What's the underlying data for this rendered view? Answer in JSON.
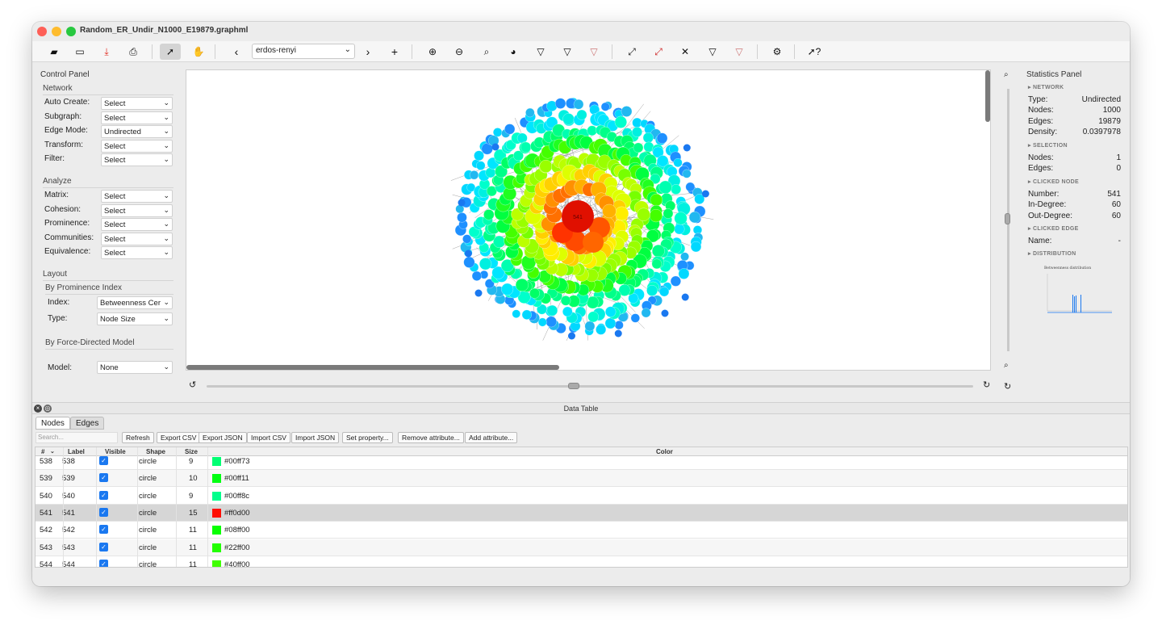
{
  "window": {
    "title": "Random_ER_Undir_N1000_E19879.graphml"
  },
  "toolbar": {
    "network_select": "erdos-renyi",
    "prev_glyph": "‹",
    "next_glyph": "›",
    "add_glyph": "+"
  },
  "control_panel": {
    "title": "Control Panel",
    "network_section": "Network",
    "network_rows": [
      {
        "label": "Auto Create:",
        "value": "Select"
      },
      {
        "label": "Subgraph:",
        "value": "Select"
      },
      {
        "label": "Edge Mode:",
        "value": "Undirected"
      },
      {
        "label": "Transform:",
        "value": "Select"
      },
      {
        "label": "Filter:",
        "value": "Select"
      }
    ],
    "analyze_section": "Analyze",
    "analyze_rows": [
      {
        "label": "Matrix:",
        "value": "Select"
      },
      {
        "label": "Cohesion:",
        "value": "Select"
      },
      {
        "label": "Prominence:",
        "value": "Select"
      },
      {
        "label": "Communities:",
        "value": "Select"
      },
      {
        "label": "Equivalence:",
        "value": "Select"
      }
    ],
    "layout_section": "Layout",
    "prominence_subsection": "By Prominence Index",
    "index_label": "Index:",
    "index_value": "Betweenness Cer",
    "type_label": "Type:",
    "type_value": "Node Size",
    "force_subsection": "By Force-Directed Model",
    "model_label": "Model:",
    "model_value": "None"
  },
  "graph": {
    "center_node_label": "541"
  },
  "stats": {
    "title": "Statistics Panel",
    "network_header": "▸ NETWORK",
    "type_label": "Type:",
    "type_value": "Undirected",
    "nodes_label": "Nodes:",
    "nodes_value": "1000",
    "edges_label": "Edges:",
    "edges_value": "19879",
    "density_label": "Density:",
    "density_value": "0.0397978",
    "selection_header": "▸ SELECTION",
    "sel_nodes_label": "Nodes:",
    "sel_nodes_value": "1",
    "sel_edges_label": "Edges:",
    "sel_edges_value": "0",
    "clicked_node_header": "▸ CLICKED NODE",
    "number_label": "Number:",
    "number_value": "541",
    "indegree_label": "In-Degree:",
    "indegree_value": "60",
    "outdegree_label": "Out-Degree:",
    "outdegree_value": "60",
    "clicked_edge_header": "▸ CLICKED EDGE",
    "name_label": "Name:",
    "name_value": "-",
    "distribution_header": "▸ DISTRIBUTION",
    "dist_chart_title": "Betweenness distribution"
  },
  "data_table": {
    "title": "Data Table",
    "tab_nodes": "Nodes",
    "tab_edges": "Edges",
    "search_placeholder": "Search...",
    "buttons": [
      "Refresh",
      "Export CSV",
      "Export JSON",
      "Import CSV",
      "Import JSON",
      "Set property...",
      "Remove attribute...",
      "Add attribute..."
    ],
    "columns": {
      "num": "#",
      "label": "Label",
      "visible": "Visible",
      "shape": "Shape",
      "size": "Size",
      "color": "Color"
    },
    "rows": [
      {
        "num": "538",
        "label": "538",
        "visible": true,
        "shape": "circle",
        "size": "9",
        "color": "#00ff73"
      },
      {
        "num": "539",
        "label": "539",
        "visible": true,
        "shape": "circle",
        "size": "10",
        "color": "#00ff11"
      },
      {
        "num": "540",
        "label": "540",
        "visible": true,
        "shape": "circle",
        "size": "9",
        "color": "#00ff8c"
      },
      {
        "num": "541",
        "label": "541",
        "visible": true,
        "shape": "circle",
        "size": "15",
        "color": "#ff0d00"
      },
      {
        "num": "542",
        "label": "542",
        "visible": true,
        "shape": "circle",
        "size": "11",
        "color": "#08ff00"
      },
      {
        "num": "543",
        "label": "543",
        "visible": true,
        "shape": "circle",
        "size": "11",
        "color": "#22ff00"
      },
      {
        "num": "544",
        "label": "544",
        "visible": true,
        "shape": "circle",
        "size": "11",
        "color": "#40ff00"
      }
    ]
  }
}
